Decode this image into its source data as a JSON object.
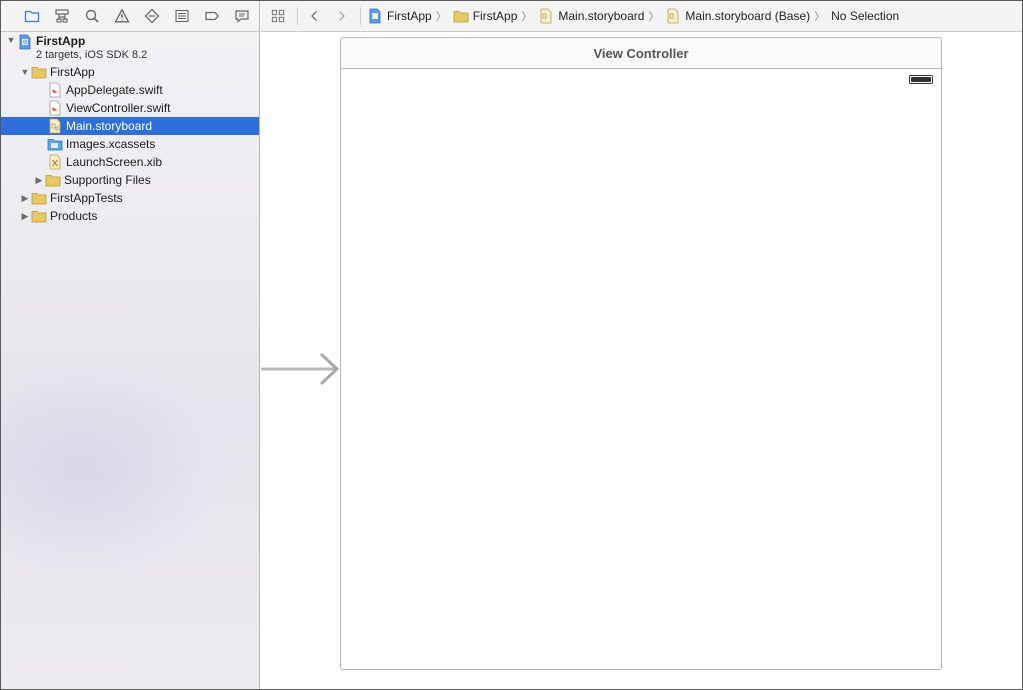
{
  "toolbar": {
    "icons": [
      "folder-icon",
      "hierarchy-icon",
      "search-icon",
      "warning-icon",
      "test-diamond-icon",
      "list-icon",
      "breakpoint-icon",
      "chat-icon"
    ]
  },
  "navigator": {
    "project": {
      "name": "FirstApp",
      "subtitle": "2 targets, iOS SDK 8.2"
    },
    "items": [
      {
        "label": "FirstApp",
        "type": "folder",
        "expanded": true
      },
      {
        "label": "AppDelegate.swift",
        "type": "swift"
      },
      {
        "label": "ViewController.swift",
        "type": "swift"
      },
      {
        "label": "Main.storyboard",
        "type": "storyboard",
        "selected": true
      },
      {
        "label": "Images.xcassets",
        "type": "assets"
      },
      {
        "label": "LaunchScreen.xib",
        "type": "xib"
      },
      {
        "label": "Supporting Files",
        "type": "folder",
        "expanded": false
      },
      {
        "label": "FirstAppTests",
        "type": "folder",
        "expanded": false
      },
      {
        "label": "Products",
        "type": "folder",
        "expanded": false
      }
    ]
  },
  "jumpbar": {
    "crumbs": [
      "FirstApp",
      "FirstApp",
      "Main.storyboard",
      "Main.storyboard (Base)",
      "No Selection"
    ]
  },
  "canvas": {
    "scene_title": "View Controller"
  },
  "colors": {
    "selection": "#2e6fde",
    "folder": "#e8c860"
  }
}
